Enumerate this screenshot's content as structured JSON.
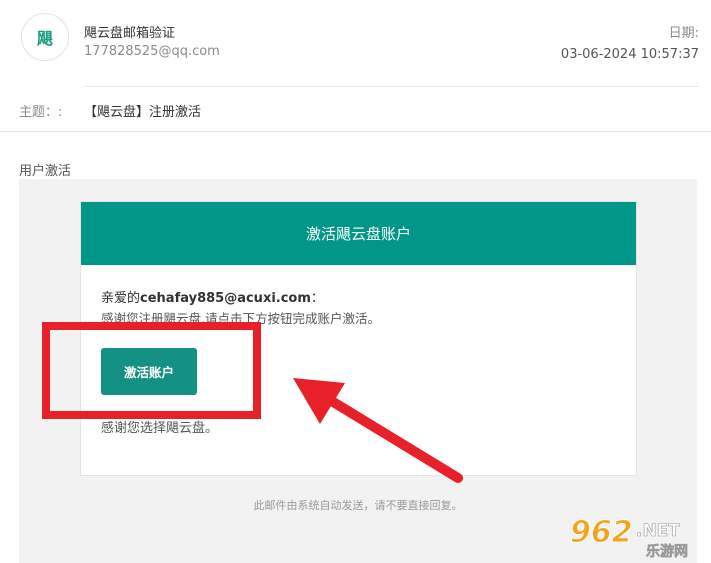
{
  "header": {
    "avatar_text": "飓",
    "sender_name": "飓云盘邮箱验证",
    "sender_email": "177828525@qq.com",
    "date_label": "日期:",
    "date_value": "03-06-2024 10:57:37"
  },
  "subject": {
    "label": "主题：:",
    "value": "【飓云盘】注册激活"
  },
  "section_label": "用户激活",
  "card": {
    "title": "激活飓云盘账户",
    "greeting_prefix": "亲爱的",
    "greeting_email": "cehafay885@acuxi.com",
    "greeting_suffix": "：",
    "instruction": "感谢您注册飓云盘,请点击下方按钮完成账户激活。",
    "button_label": "激活账户",
    "thanks": "感谢您选择飓云盘。"
  },
  "footer_note": "此邮件由系统自动发送，请不要直接回复。",
  "watermark": {
    "number": "962",
    "suffix": ".NET",
    "tagline": "乐游网"
  },
  "colors": {
    "brand_teal": "#009688",
    "button_teal": "#139184",
    "annotation_red": "#e8202a"
  },
  "icons": {
    "avatar": "sender-avatar-icon",
    "arrow": "red-arrow-icon"
  }
}
